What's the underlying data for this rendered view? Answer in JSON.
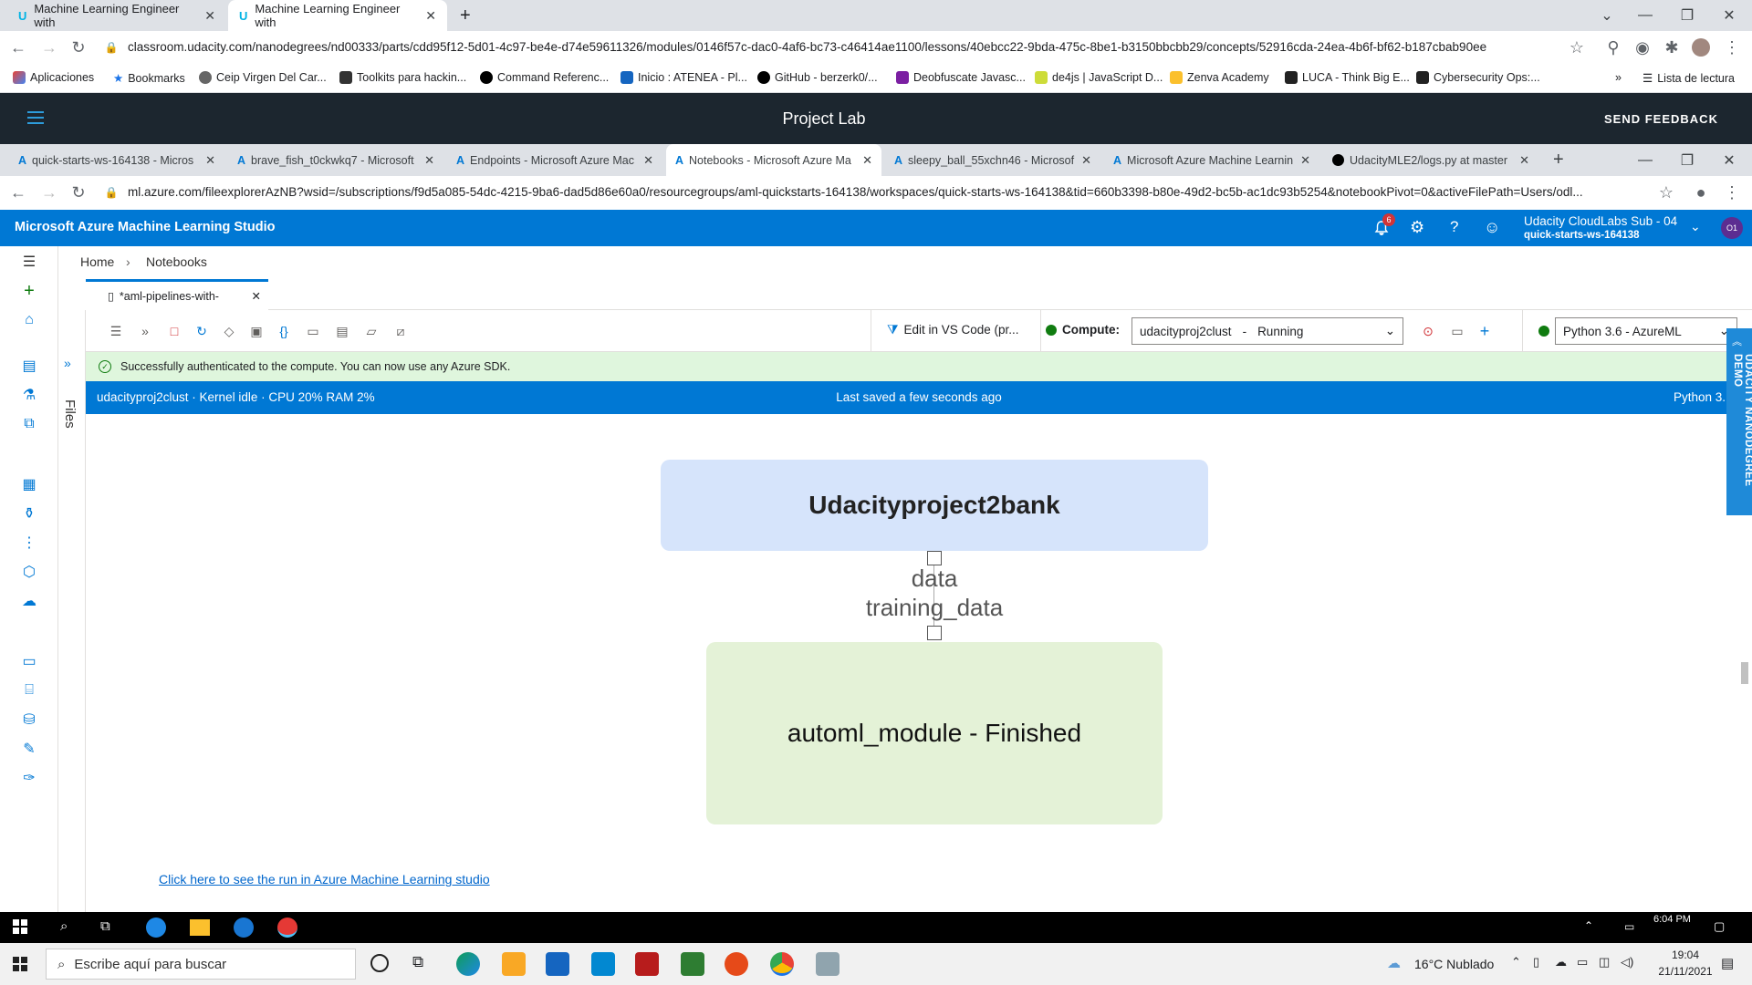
{
  "outer_browser": {
    "tabs": [
      {
        "title": "Machine Learning Engineer with"
      },
      {
        "title": "Machine Learning Engineer with"
      }
    ],
    "url": "classroom.udacity.com/nanodegrees/nd00333/parts/cdd95f12-5d01-4c97-be4e-d74e59611326/modules/0146f57c-dac0-4af6-bc73-c46414ae1100/lessons/40ebcc22-9bda-475c-8be1-b3150bbcbb29/concepts/52916cda-24ea-4b6f-bf62-b187cbab90ee",
    "bookmarks": [
      "Aplicaciones",
      "Bookmarks",
      "Ceip Virgen Del Car...",
      "Toolkits para hackin...",
      "Command Referenc...",
      "Inicio : ATENEA - Pl...",
      "GitHub - berzerk0/...",
      "Deobfuscate Javasc...",
      "de4js | JavaScript D...",
      "Zenva Academy",
      "LUCA - Think Big E...",
      "Cybersecurity Ops:..."
    ],
    "reading_list": "Lista de lectura"
  },
  "project_lab": {
    "title": "Project Lab",
    "send_feedback": "SEND FEEDBACK"
  },
  "inner_browser": {
    "tabs": [
      {
        "title": "quick-starts-ws-164138 - Micros"
      },
      {
        "title": "brave_fish_t0ckwkq7 - Microsoft"
      },
      {
        "title": "Endpoints - Microsoft Azure Mac"
      },
      {
        "title": "Notebooks - Microsoft Azure Ma"
      },
      {
        "title": "sleepy_ball_55xchn46 - Microsof"
      },
      {
        "title": "Microsoft Azure Machine Learnin"
      },
      {
        "title": "UdacityMLE2/logs.py at master"
      }
    ],
    "url": "ml.azure.com/fileexplorerAzNB?wsid=/subscriptions/f9d5a085-54dc-4215-9ba6-dad5d86e60a0/resourcegroups/aml-quickstarts-164138/workspaces/quick-starts-ws-164138&tid=660b3398-b80e-49d2-bc5b-ac1dc93b5254&notebookPivot=0&activeFilePath=Users/odl..."
  },
  "aml": {
    "app_title": "Microsoft Azure Machine Learning Studio",
    "notification_count": "6",
    "subscription": "Udacity CloudLabs Sub - 04",
    "workspace": "quick-starts-ws-164138",
    "avatar_initials": "O1",
    "breadcrumb": {
      "home": "Home",
      "current": "Notebooks"
    },
    "files_label": "Files",
    "notebook_tab": "*aml-pipelines-with-",
    "edit_vscode": "Edit in VS Code (pr...",
    "compute_label": "Compute:",
    "compute_value": "udacityproj2clust",
    "compute_sep": "-",
    "compute_status": "Running",
    "kernel": "Python 3.6 - AzureML",
    "auth_message": "Successfully authenticated to the compute. You can now use any Azure SDK.",
    "status_left": "udacityproj2clust · Kernel idle · CPU 20%  RAM  2%",
    "status_center": "Last saved a few seconds ago",
    "status_right": "Python 3.",
    "side_tab": "UDACITY NANODEGREE DEMO"
  },
  "pipeline": {
    "top_node": "Udacityproject2bank",
    "edge_label_1": "data",
    "edge_label_2": "training_data",
    "bottom_node": "automl_module - Finished",
    "link": "Click here to see the run in Azure Machine Learning studio"
  },
  "inner_taskbar": {
    "time": "6:04 PM"
  },
  "taskbar": {
    "search_placeholder": "Escribe aquí para buscar",
    "weather": "16°C  Nublado",
    "time": "19:04",
    "date": "21/11/2021"
  },
  "colors": {
    "azure_blue": "#0078d4",
    "lab_bar": "#1c262f",
    "auth_green": "#dff6dd"
  }
}
